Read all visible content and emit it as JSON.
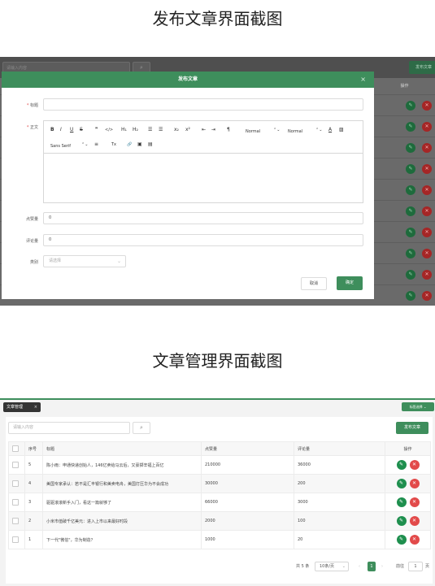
{
  "captions": {
    "publish": "发布文章界面截图",
    "manage": "文章管理界面截图"
  },
  "publish_screen": {
    "background": {
      "search_placeholder": "请输入内容",
      "search_icon": "search-icon",
      "add_button": "发布文章",
      "ops_header": "操作"
    },
    "modal": {
      "title": "发布文章",
      "close": "×",
      "title_label": "标题",
      "title_value": "",
      "content_label": "正文",
      "likes_label": "点赞量",
      "likes_value": "0",
      "comments_label": "评论量",
      "comments_value": "0",
      "category_label": "类别",
      "category_placeholder": "请选择",
      "cancel": "取消",
      "confirm": "确定",
      "toolbar": {
        "bold": "B",
        "italic": "I",
        "underline": "U",
        "strike": "S",
        "quote": "❞",
        "code": "</>",
        "h1": "H₁",
        "h2": "H₂",
        "ol": "☰",
        "ul": "☰",
        "sub": "x₂",
        "sup": "x²",
        "outdent": "⇤",
        "indent": "⇥",
        "direction": "¶",
        "size": "Normal",
        "header": "Normal",
        "color": "A",
        "background": "▨",
        "font": "Sans Serif",
        "align": "≡",
        "clean": "Tx",
        "link": "🔗",
        "image": "▣",
        "video": "▤"
      }
    }
  },
  "manage_screen": {
    "tab_label": "文章管理",
    "tab_close": "×",
    "close_menu": "标签选择 ⌄",
    "search_placeholder": "请输入内容",
    "add_button": "发布文章",
    "table": {
      "headers": [
        "序号",
        "标题",
        "点赞量",
        "评论量",
        "操作"
      ],
      "rows": [
        {
          "no": "5",
          "title": "陈小雨：申通快递创始人，146亿卖给马云后，又豪掷辛福上百亿",
          "likes": "210000",
          "comments": "36000"
        },
        {
          "no": "4",
          "title": "美国专家承认：若不是汇丰银行和美卖电舟，美国打压华为不会成功",
          "likes": "30000",
          "comments": "200"
        },
        {
          "no": "3",
          "title": "驱驱滚滚新手入门，看这一篇就够了",
          "likes": "66000",
          "comments": "3000"
        },
        {
          "no": "2",
          "title": "小米市值破千亿美元：进入上市以来最好时段",
          "likes": "2000",
          "comments": "100"
        },
        {
          "no": "1",
          "title": "下一代\"微信\"，华为制造？",
          "likes": "1000",
          "comments": "20"
        }
      ]
    },
    "pagination": {
      "total": "共 5 条",
      "page_size": "10条/页",
      "prev": "‹",
      "current": "1",
      "next": "›",
      "goto_label": "前往",
      "goto_value": "1",
      "page_unit": "页"
    }
  },
  "colors": {
    "accent_green": "#3e8e5c",
    "delete_red": "#e24a4a"
  }
}
